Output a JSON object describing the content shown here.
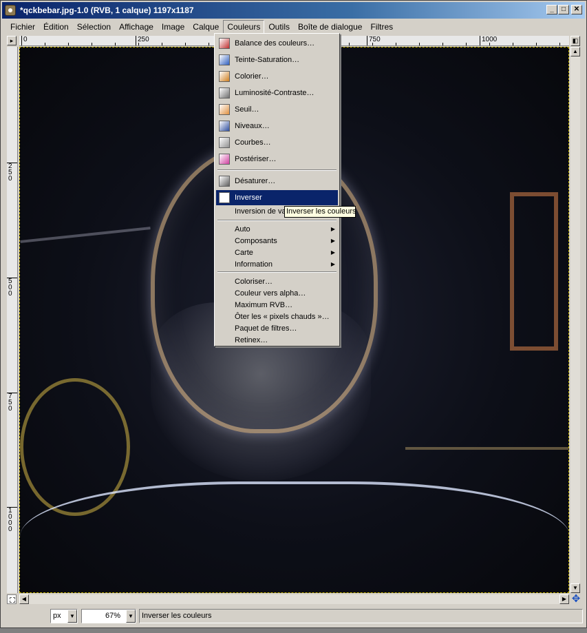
{
  "window": {
    "title": "*qckbebar.jpg-1.0 (RVB, 1 calque) 1197x1187",
    "buttons": {
      "minimize": "_",
      "maximize": "□",
      "close": "✕"
    }
  },
  "menubar": [
    {
      "label": "Fichier"
    },
    {
      "label": "Édition"
    },
    {
      "label": "Sélection"
    },
    {
      "label": "Affichage"
    },
    {
      "label": "Image"
    },
    {
      "label": "Calque"
    },
    {
      "label": "Couleurs"
    },
    {
      "label": "Outils"
    },
    {
      "label": "Boîte de dialogue"
    },
    {
      "label": "Filtres"
    }
  ],
  "active_menu": "Couleurs",
  "ruler": {
    "h_labels": [
      "0",
      "250",
      "750",
      "1000"
    ],
    "v_labels": [
      "2\n5\n0",
      "5\n0\n0",
      "7\n5\n0",
      "1\n0\n0\n0"
    ]
  },
  "dropdown": {
    "items_with_icons": [
      {
        "label": "Balance des couleurs…",
        "icon": "color-balance-icon",
        "color": "#c03030"
      },
      {
        "label": "Teinte-Saturation…",
        "icon": "hue-saturation-icon",
        "color": "#3060c0"
      },
      {
        "label": "Colorier…",
        "icon": "colorize-icon",
        "color": "#d08020"
      },
      {
        "label": "Luminosité-Contraste…",
        "icon": "brightness-contrast-icon",
        "color": "#707070"
      },
      {
        "label": "Seuil…",
        "icon": "threshold-icon",
        "color": "#e09040"
      },
      {
        "label": "Niveaux…",
        "icon": "levels-icon",
        "color": "#3050a0"
      },
      {
        "label": "Courbes…",
        "icon": "curves-icon",
        "color": "#909090"
      },
      {
        "label": "Postériser…",
        "icon": "posterize-icon",
        "color": "#d040a0"
      }
    ],
    "desaturate": {
      "label": "Désaturer…",
      "icon": "desaturate-icon",
      "color": "#606060"
    },
    "invert": {
      "label": "Inverser",
      "icon": "invert-icon",
      "color": "#ffffff"
    },
    "value_invert": {
      "label": "Inversion de va"
    },
    "submenus": [
      {
        "label": "Auto"
      },
      {
        "label": "Composants"
      },
      {
        "label": "Carte"
      },
      {
        "label": "Information"
      }
    ],
    "plugins": [
      {
        "label": "Coloriser…"
      },
      {
        "label": "Couleur vers alpha…"
      },
      {
        "label": "Maximum RVB…"
      },
      {
        "label": "Ôter les « pixels chauds »…"
      },
      {
        "label": "Paquet de filtres…"
      },
      {
        "label": "Retinex…"
      }
    ]
  },
  "tooltip": "Inverser les couleurs",
  "statusbar": {
    "unit": "px",
    "zoom": "67%",
    "message": "Inverser les couleurs"
  }
}
